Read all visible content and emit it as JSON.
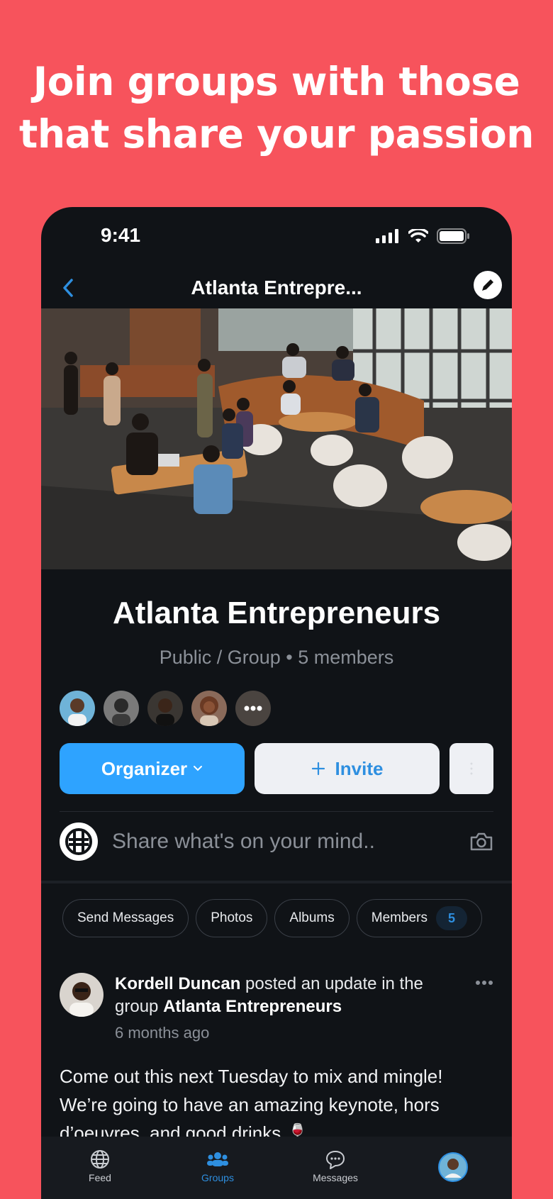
{
  "promo": {
    "headline_line1": "Join groups with those",
    "headline_line2": "that share your passion"
  },
  "status_bar": {
    "time": "9:41"
  },
  "navbar": {
    "title": "Atlanta Entrepre..."
  },
  "group": {
    "name": "Atlanta Entrepreneurs",
    "meta": "Public / Group • 5 members",
    "organizer_label": "Organizer",
    "invite_label": "Invite"
  },
  "composer": {
    "placeholder": "Share what's on your mind.."
  },
  "filters": {
    "send_messages": "Send Messages",
    "photos": "Photos",
    "albums": "Albums",
    "members": "Members",
    "members_count": "5"
  },
  "post": {
    "author": "Kordell Duncan",
    "action": " posted an update in the group ",
    "group": "Atlanta Entrepreneurs",
    "time": "6 months ago",
    "body_line1": "Come out this next Tuesday to mix and mingle!",
    "body_line2": "We’re going to have an amazing keynote, hors",
    "body_line3": "d’oeuvres, and good drinks"
  },
  "tabbar": {
    "feed": "Feed",
    "groups": "Groups",
    "messages": "Messages"
  },
  "colors": {
    "background": "#f7535c",
    "app_bg": "#101317",
    "accent": "#2ea3ff"
  }
}
